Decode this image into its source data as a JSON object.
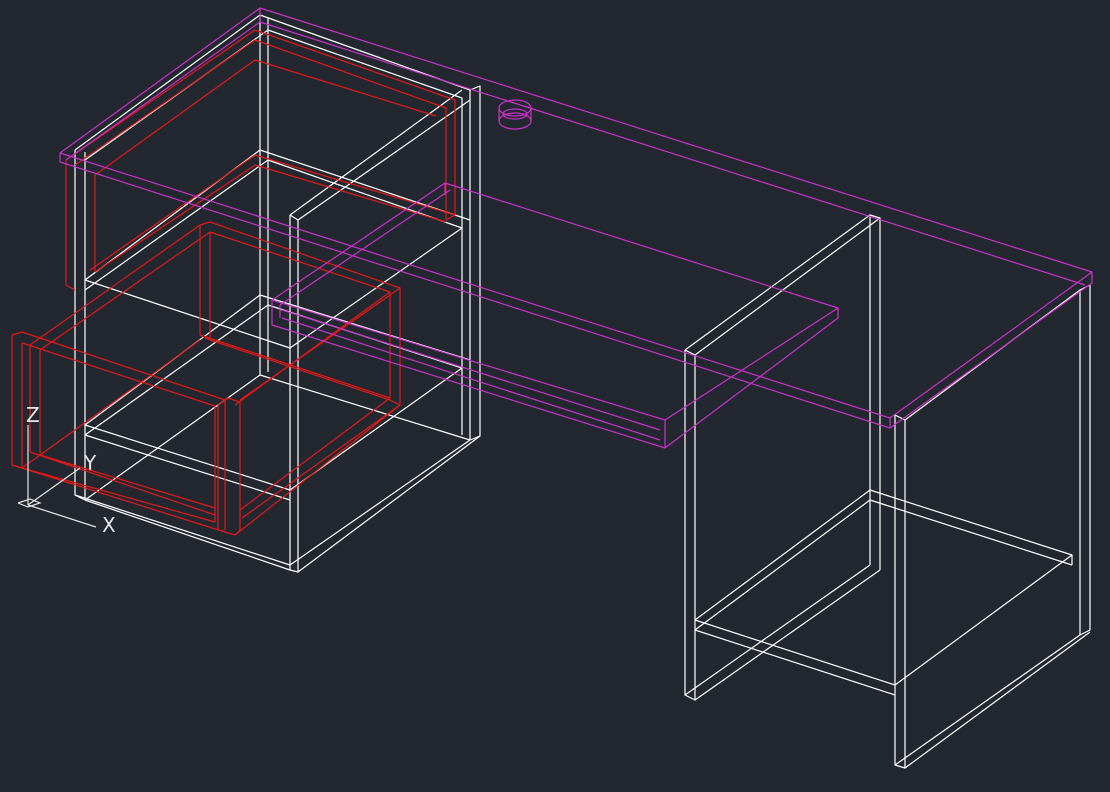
{
  "colors": {
    "background": "#232830",
    "frame": "#ffffff",
    "drawers": "#e11919",
    "top_and_shelf": "#c832c8",
    "ucs": "#e6e6e6"
  },
  "ucs_icon": {
    "z_label": "Z",
    "y_label": "Y",
    "x_label": "X"
  }
}
